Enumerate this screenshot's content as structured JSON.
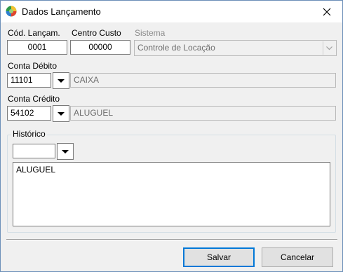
{
  "window": {
    "title": "Dados Lançamento",
    "close_symbol": "✕"
  },
  "fields": {
    "cod_lancam": {
      "label": "Cód. Lançam.",
      "value": "0001"
    },
    "centro_custo": {
      "label": "Centro Custo",
      "value": "00000"
    },
    "sistema": {
      "label": "Sistema",
      "value": "Controle de Locação"
    },
    "conta_debito": {
      "label": "Conta Débito",
      "code": "11101",
      "description": "CAIXA"
    },
    "conta_credito": {
      "label": "Conta Crédito",
      "code": "54102",
      "description": "ALUGUEL"
    },
    "historico": {
      "label": "Histórico",
      "combo_value": "",
      "text": "ALUGUEL"
    }
  },
  "buttons": {
    "save": {
      "label": "Salvar"
    },
    "cancel": {
      "label": "Cancelar"
    }
  },
  "colors": {
    "accent": "#0078d7",
    "disabled_text": "#8a8a8a"
  }
}
